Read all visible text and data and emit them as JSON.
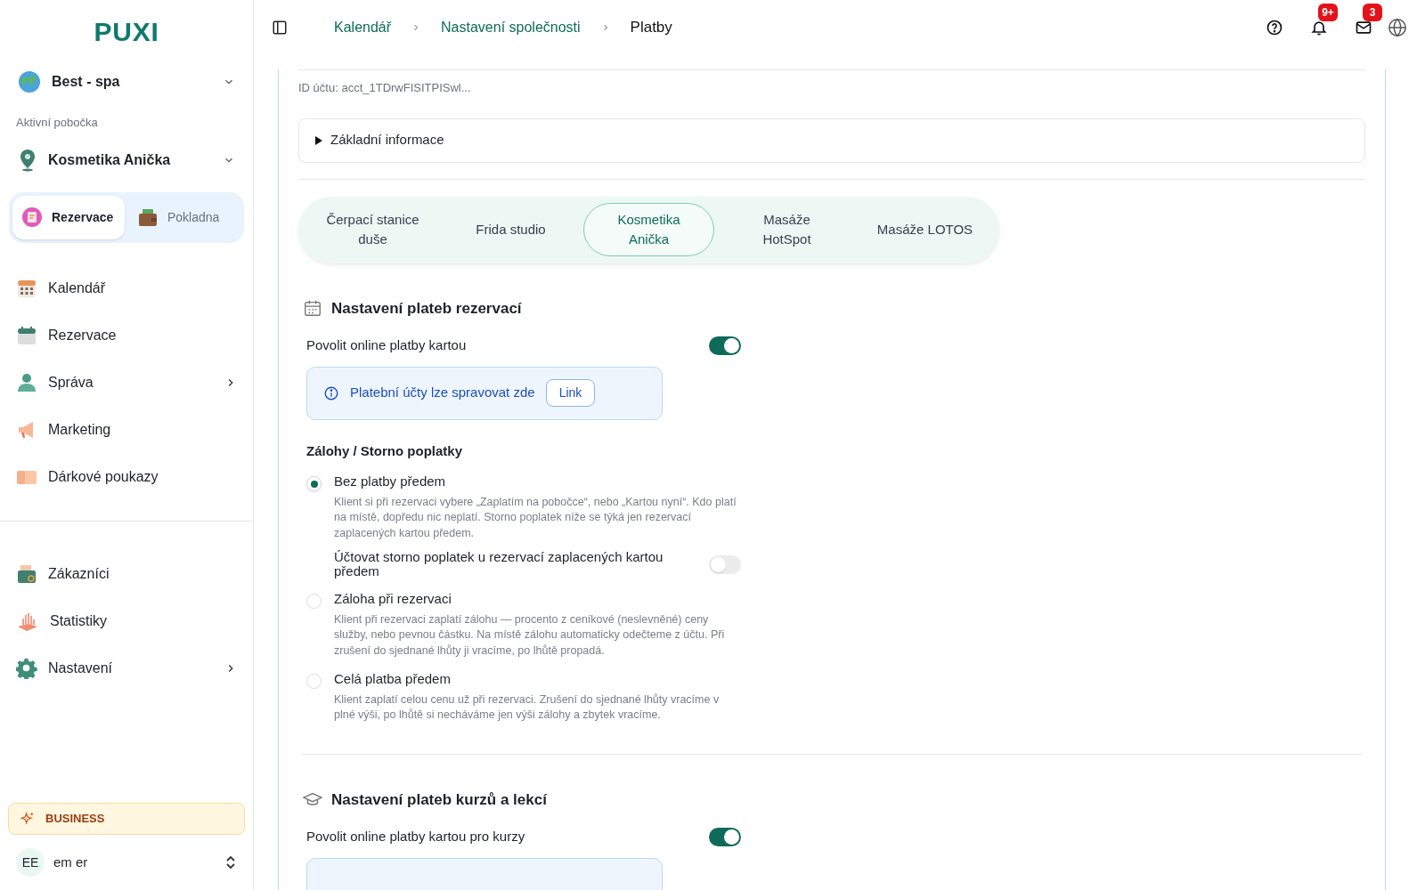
{
  "sidebar": {
    "logo": "PUXI",
    "company": {
      "name": "Best - spa"
    },
    "branch_label": "Aktivní pobočka",
    "branch": {
      "name": "Kosmetika Anička"
    },
    "modes": [
      {
        "label": "Rezervace",
        "selected": true
      },
      {
        "label": "Pokladna",
        "selected": false
      }
    ],
    "nav_items": [
      {
        "label": "Kalendář",
        "has_submenu": false
      },
      {
        "label": "Rezervace",
        "has_submenu": false
      },
      {
        "label": "Správa",
        "has_submenu": true
      },
      {
        "label": "Marketing",
        "has_submenu": false
      },
      {
        "label": "Dárkové poukazy",
        "has_submenu": false
      }
    ],
    "nav_items_2": [
      {
        "label": "Zákazníci",
        "has_submenu": false
      },
      {
        "label": "Statistiky",
        "has_submenu": false
      },
      {
        "label": "Nastavení",
        "has_submenu": true
      }
    ],
    "plan": "BUSINESS",
    "user": {
      "initials": "EE",
      "name": "em er"
    }
  },
  "header": {
    "breadcrumbs": [
      {
        "label": "Kalendář",
        "current": false
      },
      {
        "label": "Nastavení společnosti",
        "current": false
      },
      {
        "label": "Platby",
        "current": true
      }
    ],
    "notifications_badge": "9+",
    "messages_badge": "3"
  },
  "content": {
    "account_id": "ID účtu: acct_1TDrwFISITPISwl...",
    "details": {
      "label": "Základní informace",
      "expanded": false
    },
    "branch_tabs": [
      {
        "label": "Čerpací stanice duše",
        "selected": false
      },
      {
        "label": "Frida studio",
        "selected": false
      },
      {
        "label": "Kosmetika Anička",
        "selected": true
      },
      {
        "label": "Masáže HotSpot",
        "selected": false
      },
      {
        "label": "Masáže LOTOS",
        "selected": false
      }
    ],
    "sections": [
      {
        "title": "Nastavení plateb rezervací",
        "toggle": {
          "label": "Povolit online platby kartou",
          "on": true
        },
        "info": {
          "text": "Platební účty lze spravovat zde",
          "link": "Link"
        },
        "deposits": {
          "title": "Zálohy / Storno poplatky",
          "items": [
            {
              "kind": "radio",
              "label": "Bez platby předem",
              "selected": true,
              "description": "Klient si při rezervaci vybere „Zaplatím na pobočce“, nebo „Kartou nyní“. Kdo platí na místě, dopředu nic neplatí. Storno poplatek níže se týká jen rezervací zaplacených kartou předem."
            },
            {
              "kind": "toggle",
              "label": "Účtovat storno poplatek u rezervací zaplacených kartou předem",
              "on": false
            },
            {
              "kind": "radio",
              "label": "Záloha při rezervaci",
              "selected": false,
              "description": "Klient při rezervaci zaplatí zálohu — procento z ceníkové (neslevněné) ceny služby, nebo pevnou částku. Na místě zálohu automaticky odečteme z účtu. Při zrušení do sjednané lhůty ji vracíme, po lhůtě propadá."
            },
            {
              "kind": "radio",
              "label": "Celá platba předem",
              "selected": false,
              "description": "Klient zaplatí celou cenu už při rezervaci. Zrušení do sjednané lhůty vracíme v plné výši, po lhůtě si necháváme jen výši zálohy a zbytek vracíme."
            }
          ]
        }
      },
      {
        "title": "Nastavení plateb kurzů a lekcí",
        "toggle": {
          "label": "Povolit online platby kartou pro kurzy",
          "on": true
        },
        "info_box": true
      }
    ]
  }
}
